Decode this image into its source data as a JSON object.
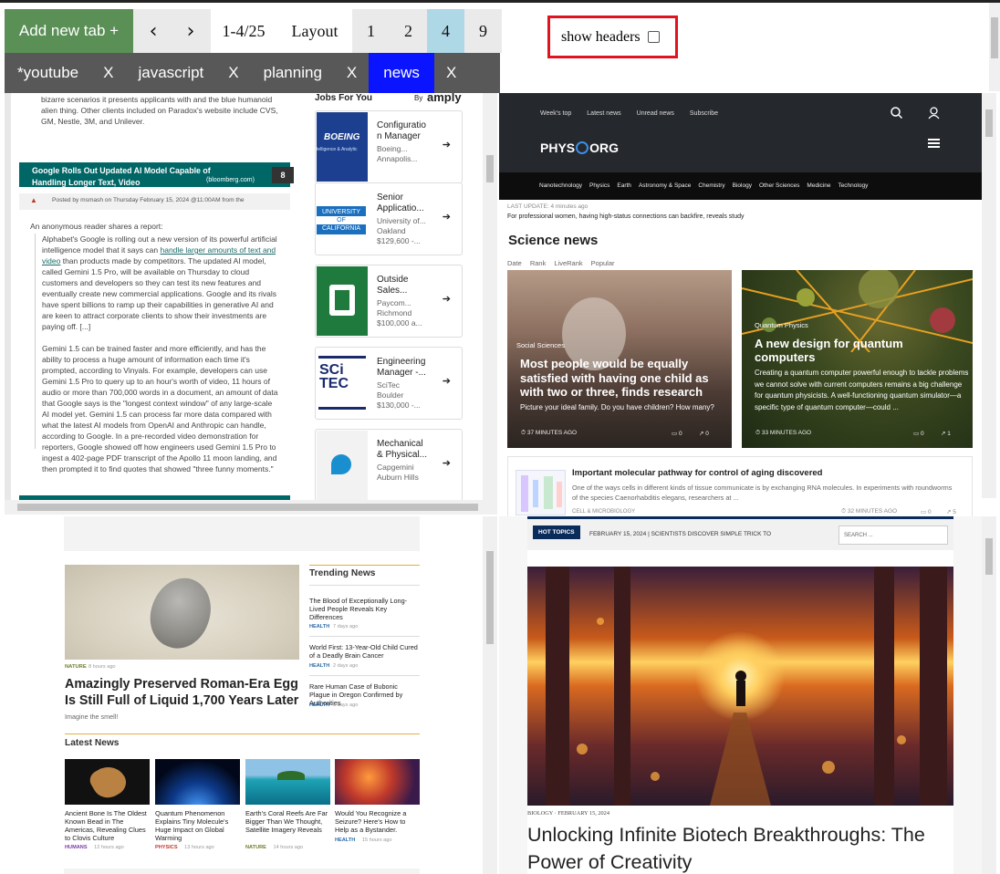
{
  "toolbar": {
    "add_tab": "Add new tab +",
    "prev": "‹",
    "next": "›",
    "page_range": "1-4/25",
    "layout_label": "Layout",
    "layouts": [
      "1",
      "2",
      "4",
      "9"
    ],
    "selected_layout": "4",
    "show_headers_label": "show headers",
    "show_headers_checked": false
  },
  "tabs": [
    {
      "label": "*youtube",
      "close": "X"
    },
    {
      "label": "javascript",
      "close": "X"
    },
    {
      "label": "planning",
      "close": "X"
    },
    {
      "label": "news",
      "close": "X",
      "active": true
    }
  ],
  "pane1": {
    "top_text": "bizarre scenarios it presents applicants with and the blue humanoid alien thing. Other clients included on Paradox's website include CVS, GM, Nestle, 3M, and Unilever.",
    "jobs_header": "Jobs For You",
    "jobs_by": "By",
    "jobs_brand": "amply",
    "story_title": "Google Rolls Out Updated AI Model Capable of Handling Longer Text, Video",
    "story_source": "(bloomberg.com)",
    "story_comments": "8",
    "story_meta": "Posted by msmash on Thursday February 15, 2024 @11:00AM from the",
    "intro": "An anonymous reader shares a report:",
    "para1_a": "Alphabet's Google is rolling out a new version of its powerful artificial intelligence model that it says can",
    "para1_link": "handle larger amounts of text and video",
    "para1_b": "than products made by competitors. The updated AI model, called Gemini 1.5 Pro, will be available on Thursday to cloud customers and developers so they can test its new features and eventually create new commercial applications. Google and its rivals have spent billions to ramp up their capabilities in generative AI and are keen to attract corporate clients to show their investments are paying off. [...]",
    "para2": "Gemini 1.5 can be trained faster and more efficiently, and has the ability to process a huge amount of information each time it's prompted, according to Vinyals. For example, developers can use Gemini 1.5 Pro to query up to an hour's worth of video, 11 hours of audio or more than 700,000 words in a document, an amount of data that Google says is the \"longest context window\" of any large-scale AI model yet. Gemini 1.5 can process far more data compared with what the latest AI models from OpenAI and Anthropic can handle, according to Google. In a pre-recorded video demonstration for reporters, Google showed off how engineers used Gemini 1.5 Pro to ingest a 402-page PDF transcript of the Apollo 11 moon landing, and then prompted it to find quotes that showed \"three funny moments.\"",
    "jobs": [
      {
        "title": "Configuratio n Manager",
        "company": "Boeing...",
        "location": "Annapolis...",
        "salary": "",
        "logo": "boeing-logo"
      },
      {
        "title": "Senior Applicatio...",
        "company": "University of...",
        "location": "Oakland",
        "salary": "$129,600 -...",
        "logo": "uc-logo"
      },
      {
        "title": "Outside Sales...",
        "company": "Paycom...",
        "location": "Richmond",
        "salary": "$100,000 a...",
        "logo": "paycom-logo"
      },
      {
        "title": "Engineering Manager -...",
        "company": "SciTec",
        "location": "Boulder",
        "salary": "$130,000 -...",
        "logo": "scitec-logo"
      },
      {
        "title": "Mechanical & Physical...",
        "company": "Capgemini",
        "location": "Auburn Hills",
        "salary": "",
        "logo": "capgemini-logo"
      }
    ],
    "boeing_text": "BOEING",
    "boeing_sub": "telligence & Analytic",
    "uc_text1": "UNIVERSITY",
    "uc_text2": "OF",
    "uc_text3": "CALIFORNIA",
    "scitec_text1": "SCi",
    "scitec_text2": "TEC"
  },
  "pane2": {
    "nav_top": [
      "Week's top",
      "Latest news",
      "Unread news",
      "Subscribe"
    ],
    "logo_a": "PHYS",
    "logo_b": "ORG",
    "categories": [
      "Nanotechnology",
      "Physics",
      "Earth",
      "Astronomy & Space",
      "Chemistry",
      "Biology",
      "Other Sciences",
      "Medicine",
      "Technology"
    ],
    "last_update": "LAST UPDATE: 4 minutes ago",
    "headline": "For professional women, having high-status connections can backfire, reveals study",
    "section_title": "Science news",
    "sort_tabs": [
      "Date",
      "Rank",
      "LiveRank",
      "Popular"
    ],
    "card1": {
      "category": "Social Sciences",
      "title": "Most people would be equally satisfied with having one child as with two or three, finds research",
      "desc": "Picture your ideal family. Do you have children? How many?",
      "time": "37 MINUTES AGO",
      "comments": "0",
      "shares": "0"
    },
    "card2": {
      "category": "Quantum Physics",
      "title": "A new design for quantum computers",
      "desc": "Creating a quantum computer powerful enough to tackle problems we cannot solve with current computers remains a big challenge for quantum physicists. A well-functioning quantum simulator—a specific type of quantum computer—could ...",
      "time": "33 MINUTES AGO",
      "comments": "0",
      "shares": "1"
    },
    "item": {
      "title": "Important molecular pathway for control of aging discovered",
      "desc": "One of the ways cells in different kinds of tissue communicate is by exchanging RNA molecules. In experiments with roundworms of the species Caenorhabditis elegans, researchers at ...",
      "category": "CELL & MICROBIOLOGY",
      "time": "32 MINUTES AGO",
      "comments": "0",
      "shares": "5"
    }
  },
  "pane3": {
    "main_cat": "NATURE",
    "main_time": "8 hours ago",
    "main_title": "Amazingly Preserved Roman-Era Egg Is Still Full of Liquid 1,700 Years Later",
    "main_sub": "Imagine the smell!",
    "trending_header": "Trending News",
    "trending": [
      {
        "title": "The Blood of Exceptionally Long-Lived People Reveals Key Differences",
        "cat": "HEALTH",
        "time": "7 days ago"
      },
      {
        "title": "World First: 13-Year-Old Child Cured of a Deadly Brain Cancer",
        "cat": "HEALTH",
        "time": "2 days ago"
      },
      {
        "title": "Rare Human Case of Bubonic Plague in Oregon Confirmed by Authorities",
        "cat": "HEALTH",
        "time": "3 days ago"
      }
    ],
    "latest_header": "Latest News",
    "latest": [
      {
        "title": "Ancient Bone Is The Oldest Known Bead in The Americas, Revealing Clues to Clovis Culture",
        "cat": "HUMANS",
        "time": "12 hours ago",
        "cat_color": "#7a3aa8"
      },
      {
        "title": "Quantum Phenomenon Explains Tiny Molecule's Huge Impact on Global Warming",
        "cat": "PHYSICS",
        "time": "13 hours ago",
        "cat_color": "#c0392b"
      },
      {
        "title": "Earth's Coral Reefs Are Far Bigger Than We Thought, Satellite Imagery Reveals",
        "cat": "NATURE",
        "time": "14 hours ago",
        "cat_color": "#6b7d2a"
      },
      {
        "title": "Would You Recognize a Seizure? Here's How to Help as a Bystander.",
        "cat": "HEALTH",
        "time": "15 hours ago",
        "cat_color": "#2a6aa7"
      }
    ]
  },
  "pane4": {
    "hot_topics": "HOT TOPICS",
    "ticker": "FEBRUARY 15, 2024 | SCIENTISTS DISCOVER SIMPLE TRICK TO",
    "search_placeholder": "SEARCH ...",
    "category": "BIOLOGY",
    "date": "FEBRUARY 15, 2024",
    "title": "Unlocking Infinite Biotech Breakthroughs: The Power of Creativity"
  }
}
